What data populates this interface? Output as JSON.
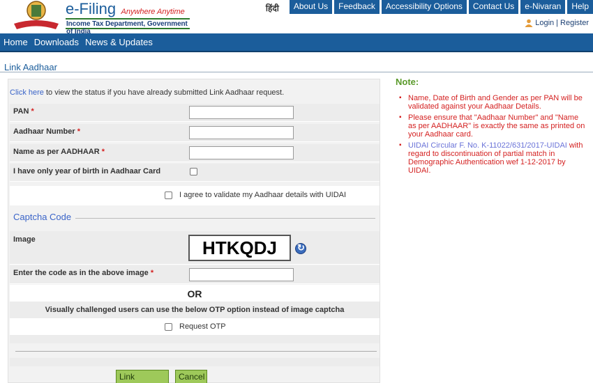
{
  "header": {
    "brand_title": "e-Filing",
    "brand_tagline": "Anywhere Anytime",
    "brand_subtitle": "Income Tax Department, Government of India",
    "hindi_link": "हिंदी",
    "top_nav": [
      "About Us",
      "Feedback",
      "Accessibility Options",
      "Contact Us",
      "e-Nivaran",
      "Help"
    ],
    "login_label": "Login",
    "separator": "|",
    "register_label": "Register"
  },
  "main_nav": [
    "Home",
    "Downloads",
    "News & Updates"
  ],
  "page_title": "Link Aadhaar",
  "form": {
    "click_here": "Click here",
    "click_here_rest": " to view the status if you have already submitted Link Aadhaar request.",
    "pan_label": "PAN",
    "aadhaar_label": "Aadhaar Number",
    "name_label": "Name as per AADHAAR",
    "yob_label": "I have only year of birth in Aadhaar Card",
    "agree_label": "I agree to validate my Aadhaar details with UIDAI",
    "required_mark": "*",
    "captcha_heading": "Captcha Code",
    "image_label": "Image",
    "captcha_text": "HTKQDJ",
    "enter_code_label": "Enter the code as in the above image",
    "or_label": "OR",
    "visually_challenged": "Visually challenged users can use the below OTP option instead of image captcha",
    "request_otp_label": "Request OTP",
    "link_button": "Link Aadhaar",
    "cancel_button": "Cancel"
  },
  "notes": {
    "title": "Note:",
    "items": [
      "Name, Date of Birth and Gender as per PAN will be validated against your Aadhaar Details.",
      "Please ensure that \"Aadhaar Number\" and \"Name as per AADHAAR\" is exactly the same as printed on your Aadhaar card."
    ],
    "circular_link": "UIDAI Circular F. No. K-11022/631/2017-UIDAI",
    "circular_rest": " with regard to discontinuation of partial match in Demographic Authentication wef 1-12-2017 by UIDAI."
  },
  "colors": {
    "brand_blue": "#1b5d9b",
    "accent_red": "#d42121",
    "button_green": "#9ec95a",
    "note_green": "#5a9a2a"
  },
  "icons": [
    "emblem-logo",
    "user-icon",
    "refresh-icon"
  ]
}
